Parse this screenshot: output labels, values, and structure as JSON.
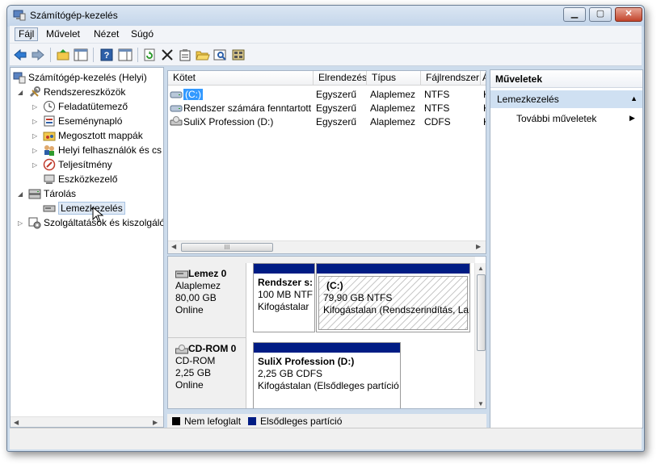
{
  "window": {
    "title": "Számítógép-kezelés",
    "min_label": "▁",
    "max_label": "▢",
    "close_label": "✕"
  },
  "menu": {
    "items": [
      "Fájl",
      "Művelet",
      "Nézet",
      "Súgó"
    ]
  },
  "toolbar": {
    "icons": [
      "back-arrow-icon",
      "forward-arrow-icon",
      "up-folder-icon",
      "show-tree-icon",
      "help-icon",
      "action-pane-icon",
      "refresh-icon",
      "delete-icon",
      "properties-icon",
      "open-folder-icon",
      "search-icon",
      "disk-icon"
    ]
  },
  "tree": {
    "root": "Számítógép-kezelés (Helyi)",
    "items": [
      {
        "label": "Rendszereszközök",
        "expander": "◢"
      },
      {
        "label": "Feladatütemező",
        "expander": "▷"
      },
      {
        "label": "Eseménynapló",
        "expander": "▷"
      },
      {
        "label": "Megosztott mappák",
        "expander": "▷"
      },
      {
        "label": "Helyi felhasználók és cs",
        "expander": "▷"
      },
      {
        "label": "Teljesítmény",
        "expander": "▷"
      },
      {
        "label": "Eszközkezelő",
        "expander": ""
      },
      {
        "label": "Tárolás",
        "expander": "◢"
      },
      {
        "label": "Lemezkezelés",
        "expander": ""
      },
      {
        "label": "Szolgáltatások és kiszolgáló",
        "expander": "▷"
      }
    ]
  },
  "volumes": {
    "columns": [
      "Kötet",
      "Elrendezés",
      "Típus",
      "Fájlrendszer",
      "Á"
    ],
    "rows": [
      [
        "(C:)",
        "Egyszerű",
        "Alaplemez",
        "NTFS",
        "K"
      ],
      [
        "Rendszer számára fenntartott",
        "Egyszerű",
        "Alaplemez",
        "NTFS",
        "K"
      ],
      [
        "SuliX Profession (D:)",
        "Egyszerű",
        "Alaplemez",
        "CDFS",
        "K"
      ]
    ]
  },
  "disks": [
    {
      "name": "Lemez 0",
      "type": "Alaplemez",
      "size": "80,00 GB",
      "status": "Online",
      "partitions": [
        {
          "name": "Rendszer s:",
          "size": "100 MB NTF",
          "status": "Kifogástalar"
        },
        {
          "name": "(C:)",
          "size": "79,90 GB NTFS",
          "status": "Kifogástalan (Rendszerindítás, Lap"
        }
      ]
    },
    {
      "name": "CD-ROM 0",
      "type": "CD-ROM",
      "size": "2,25 GB",
      "status": "Online",
      "partitions": [
        {
          "name": "SuliX Profession  (D:)",
          "size": "2,25 GB CDFS",
          "status": "Kifogástalan (Elsődleges partíció"
        }
      ]
    }
  ],
  "legend": {
    "unallocated": "Nem lefoglalt",
    "primary": "Elsődleges partíció"
  },
  "actions": {
    "header": "Műveletek",
    "section": "Lemezkezelés",
    "more": "További műveletek"
  },
  "scroll": {
    "grip": "III"
  },
  "colors": {
    "primary_partition": "#001c84",
    "unallocated": "#000000",
    "selection": "#3399ff"
  }
}
